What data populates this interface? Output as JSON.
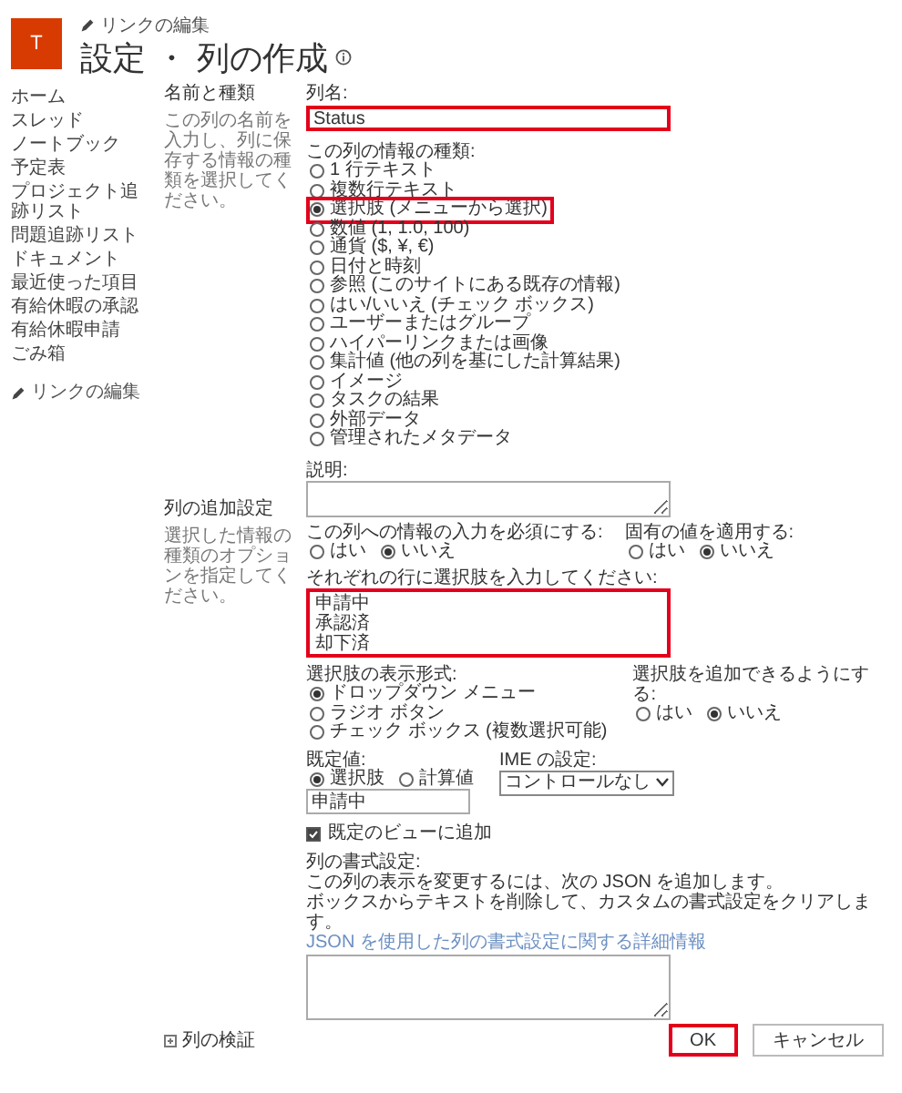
{
  "header": {
    "logo_letter": "T",
    "edit_links": "リンクの編集",
    "title": "設定 ・ 列の作成"
  },
  "nav": {
    "items": [
      {
        "label": "ホーム"
      },
      {
        "label": "スレッド"
      },
      {
        "label": "ノートブック"
      },
      {
        "label": "予定表"
      },
      {
        "label": "プロジェクト追跡リスト"
      },
      {
        "label": "問題追跡リスト"
      },
      {
        "label": "ドキュメント"
      },
      {
        "label": "最近使った項目"
      },
      {
        "label": "有給休暇の承認"
      },
      {
        "label": "有給休暇申請"
      },
      {
        "label": "ごみ箱"
      }
    ],
    "edit_links": "リンクの編集"
  },
  "sections": [
    {
      "title": "名前と種類",
      "description": "この列の名前を入力し、列に保存する情報の種類を選択してください。"
    },
    {
      "title": "列の追加設定",
      "description": "選択した情報の種類のオプションを指定してください。"
    }
  ],
  "column_name": {
    "label": "列名:",
    "value": "Status",
    "highlighted": true
  },
  "type": {
    "label": "この列の情報の種類:",
    "options": [
      {
        "label": "1 行テキスト",
        "selected": false,
        "highlighted": false
      },
      {
        "label": "複数行テキスト",
        "selected": false,
        "highlighted": false
      },
      {
        "label": "選択肢 (メニューから選択)",
        "selected": true,
        "highlighted": true
      },
      {
        "label": "数値 (1, 1.0, 100)",
        "selected": false,
        "highlighted": false
      },
      {
        "label": "通貨 ($, ¥, €)",
        "selected": false,
        "highlighted": false
      },
      {
        "label": "日付と時刻",
        "selected": false,
        "highlighted": false
      },
      {
        "label": "参照 (このサイトにある既存の情報)",
        "selected": false,
        "highlighted": false
      },
      {
        "label": "はい/いいえ (チェック ボックス)",
        "selected": false,
        "highlighted": false
      },
      {
        "label": "ユーザーまたはグループ",
        "selected": false,
        "highlighted": false
      },
      {
        "label": "ハイパーリンクまたは画像",
        "selected": false,
        "highlighted": false
      },
      {
        "label": "集計値 (他の列を基にした計算結果)",
        "selected": false,
        "highlighted": false
      },
      {
        "label": "イメージ",
        "selected": false,
        "highlighted": false
      },
      {
        "label": "タスクの結果",
        "selected": false,
        "highlighted": false
      },
      {
        "label": "外部データ",
        "selected": false,
        "highlighted": false
      },
      {
        "label": "管理されたメタデータ",
        "selected": false,
        "highlighted": false
      }
    ]
  },
  "description_field": {
    "label": "説明:"
  },
  "required": {
    "label": "この列への情報の入力を必須にする:",
    "options": [
      {
        "label": "はい",
        "selected": false
      },
      {
        "label": "いいえ",
        "selected": true
      }
    ]
  },
  "unique": {
    "label": "固有の値を適用する:",
    "options": [
      {
        "label": "はい",
        "selected": false
      },
      {
        "label": "いいえ",
        "selected": true
      }
    ]
  },
  "choices": {
    "label": "それぞれの行に選択肢を入力してください:",
    "lines": [
      "申請中",
      "承認済",
      "却下済"
    ],
    "highlighted": true
  },
  "display": {
    "label": "選択肢の表示形式:",
    "options": [
      {
        "label": "ドロップダウン メニュー",
        "selected": true
      },
      {
        "label": "ラジオ ボタン",
        "selected": false
      },
      {
        "label": "チェック ボックス (複数選択可能)",
        "selected": false
      }
    ]
  },
  "fill_in": {
    "label": "選択肢を追加できるようにする:",
    "options": [
      {
        "label": "はい",
        "selected": false
      },
      {
        "label": "いいえ",
        "selected": true
      }
    ]
  },
  "default": {
    "label": "既定値:",
    "options": [
      {
        "label": "選択肢",
        "selected": true
      },
      {
        "label": "計算値",
        "selected": false
      }
    ],
    "value": "申請中"
  },
  "ime": {
    "label": "IME の設定:",
    "value": "コントロールなし"
  },
  "add_to_view": {
    "label": "既定のビューに追加",
    "checked": true
  },
  "formatting": {
    "label": "列の書式設定:",
    "lines": [
      "この列の表示を変更するには、次の JSON を追加します。",
      "ボックスからテキストを削除して、カスタムの書式設定をクリアします。"
    ],
    "link": "JSON を使用した列の書式設定に関する詳細情報"
  },
  "validation": {
    "label": "列の検証"
  },
  "buttons": [
    {
      "label": "OK",
      "highlighted": true
    },
    {
      "label": "キャンセル",
      "highlighted": false
    }
  ]
}
